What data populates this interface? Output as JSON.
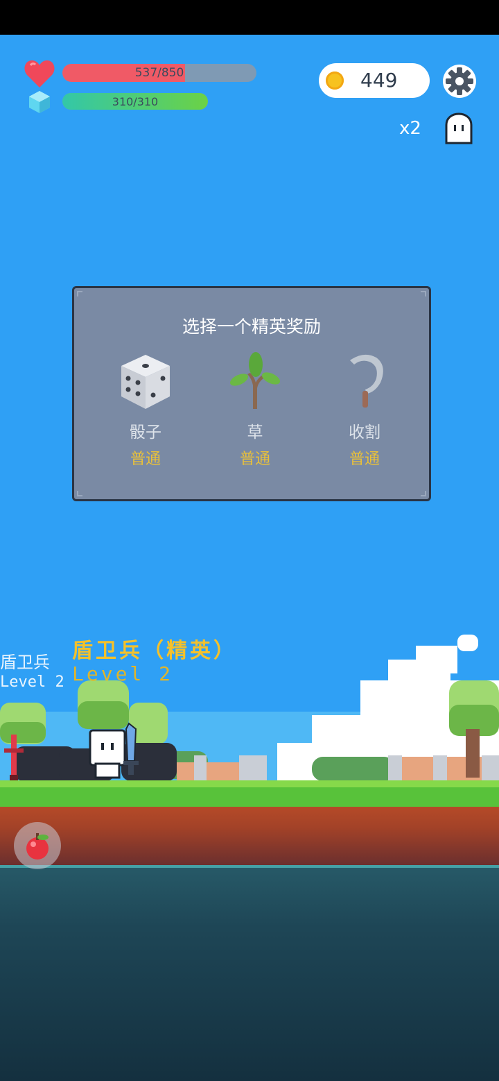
{
  "hud": {
    "hp": {
      "text": "537/850",
      "current": 537,
      "max": 850,
      "icon": "heart-icon",
      "color": "#f05a66"
    },
    "mp": {
      "text": "310/310",
      "current": 310,
      "max": 310,
      "icon": "crystal-icon",
      "color": "#4fcf7a"
    },
    "coins": {
      "value": "449",
      "icon": "coin-icon"
    },
    "settings_icon": "gear-icon",
    "speed": "x2",
    "ghost_icon": "ghost-icon"
  },
  "dialog": {
    "title": "选择一个精英奖励",
    "rewards": [
      {
        "name": "骰子",
        "rarity": "普通",
        "icon": "dice-icon"
      },
      {
        "name": "草",
        "rarity": "普通",
        "icon": "sapling-icon"
      },
      {
        "name": "收割",
        "rarity": "普通",
        "icon": "sickle-icon"
      }
    ],
    "rarity_color": "#e9c13a"
  },
  "enemy": {
    "name": "盾卫兵（精英）",
    "level": "Level 2"
  },
  "overlap_labels": {
    "name": "盾卫兵",
    "level": "Level 2"
  },
  "item_button": {
    "icon": "apple-icon"
  }
}
